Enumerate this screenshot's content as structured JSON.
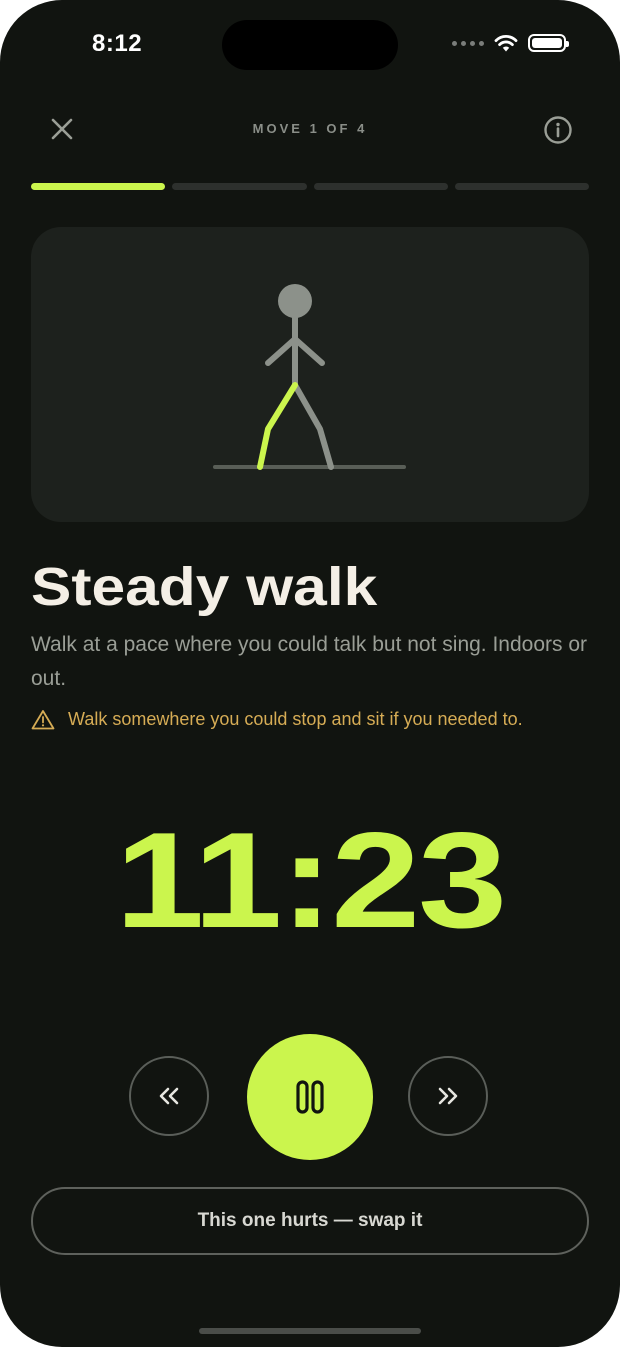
{
  "status_bar": {
    "time": "8:12",
    "icons": [
      "signal-dots-icon",
      "wifi-icon",
      "battery-icon"
    ]
  },
  "header": {
    "move_label": "MOVE 1 OF 4",
    "close_icon": "close-icon",
    "info_icon": "info-icon"
  },
  "progress": {
    "total_steps": 4,
    "current_step": 1
  },
  "illustration": {
    "icon": "walking-figure-icon",
    "highlight_color": "#cbf54d",
    "figure_color": "#8c918a"
  },
  "exercise": {
    "title": "Steady walk",
    "description": "Walk at a pace where you could talk but not sing. Indoors or out.",
    "warning": "Walk somewhere you could stop and sit if you needed to.",
    "warning_icon": "warning-triangle-icon"
  },
  "timer": {
    "value": "11:23"
  },
  "controls": {
    "rewind_icon": "double-chevron-left-icon",
    "pause_icon": "pause-icon",
    "forward_icon": "double-chevron-right-icon"
  },
  "swap_button": {
    "label": "This one hurts — swap it"
  },
  "colors": {
    "background": "#111410",
    "accent": "#cbf54d",
    "warning": "#d6ac55",
    "title": "#f4efe6",
    "muted": "#9a9e96"
  }
}
